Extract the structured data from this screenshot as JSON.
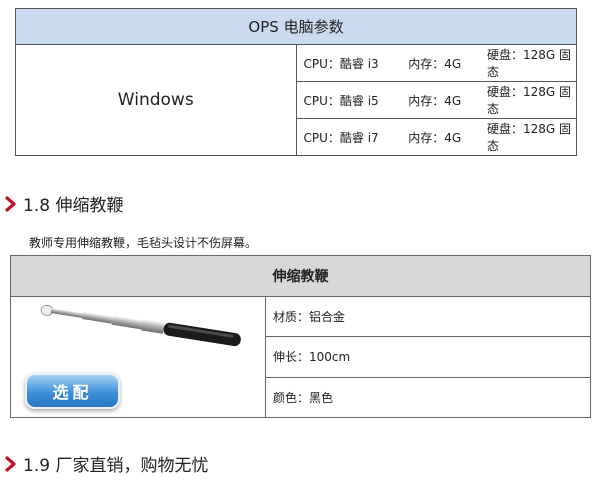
{
  "ops_table": {
    "title": "OPS 电脑参数",
    "os": "Windows",
    "rows": [
      {
        "cpu": "CPU：酷睿 i3",
        "mem": "内存：4G",
        "disk": "硬盘：128G 固态"
      },
      {
        "cpu": "CPU：酷睿 i5",
        "mem": "内存：4G",
        "disk": "硬盘：128G 固态"
      },
      {
        "cpu": "CPU：酷睿 i7",
        "mem": "内存：4G",
        "disk": "硬盘：128G 固态"
      }
    ]
  },
  "section_18": {
    "title": "1.8 伸缩教鞭",
    "description": "教师专用伸缩教鞭，毛毡头设计不伤屏幕。"
  },
  "pointer_table": {
    "header": "伸缩教鞭",
    "badge": "选配",
    "specs": [
      "材质：铝合金",
      "伸长：100cm",
      "颜色：黑色"
    ]
  },
  "section_19": {
    "title": "1.9 厂家直销，购物无忧"
  },
  "colors": {
    "arrow": "#c8102e",
    "ops_header_bg": "#c9daf1",
    "pointer_header_bg": "#d8d8d8",
    "badge": "#3c8fd8"
  }
}
